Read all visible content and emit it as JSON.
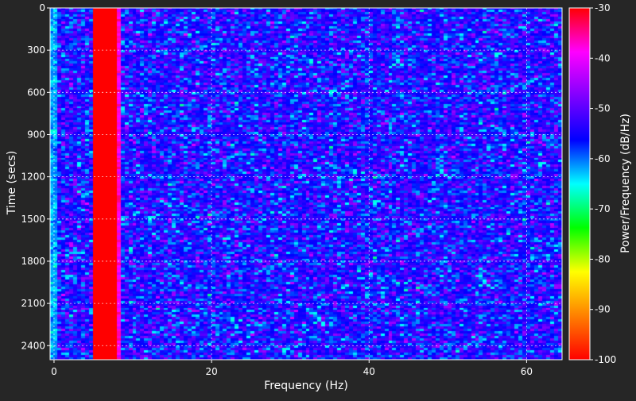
{
  "chart_data": {
    "type": "heatmap",
    "title": "",
    "xlabel": "Frequency (Hz)",
    "ylabel": "Time (secs)",
    "xlim": [
      -0.5,
      64.5
    ],
    "ylim": [
      2500,
      0
    ],
    "x_ticks": [
      "0",
      "20",
      "40",
      "60"
    ],
    "x_tick_values": [
      0,
      20,
      40,
      60
    ],
    "y_ticks": [
      "0",
      "300",
      "600",
      "900",
      "1200",
      "1500",
      "1800",
      "2100",
      "2400"
    ],
    "y_tick_values": [
      0,
      300,
      600,
      900,
      1200,
      1500,
      1800,
      2100,
      2400
    ],
    "grid": true,
    "grid_color": "#ffffff",
    "colorbar": {
      "label": "Power/Frequency (dB/Hz)",
      "range": [
        -100,
        -30
      ],
      "ticks": [
        "-30",
        "-40",
        "-50",
        "-60",
        "-70",
        "-80",
        "-90",
        "-100"
      ],
      "tick_values": [
        -30,
        -40,
        -50,
        -60,
        -70,
        -80,
        -90,
        -100
      ],
      "colormap": "gist_rainbow",
      "colors": [
        "#ff0000",
        "#ff8000",
        "#ffff00",
        "#00ff00",
        "#00ffff",
        "#0000ff",
        "#8000ff",
        "#ff00ff",
        "#ff0000"
      ]
    },
    "background_level_db": -55,
    "bands": [
      {
        "freq_range_hz": [
          5,
          8
        ],
        "level_db": -30
      },
      {
        "freq_range_hz": [
          8,
          8.5
        ],
        "level_db": -38
      },
      {
        "freq_range_hz": [
          -0.5,
          0.5
        ],
        "level_db": -62
      }
    ]
  },
  "colors": {
    "background": "#262626",
    "text": "#ffffff"
  }
}
